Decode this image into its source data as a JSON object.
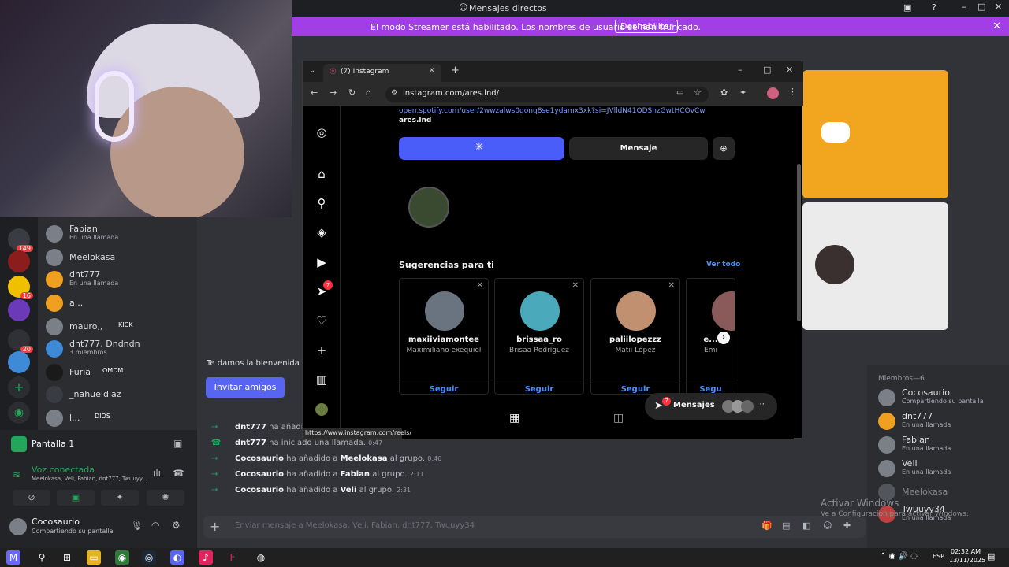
{
  "titlebar": {
    "title": "Mensajes directos"
  },
  "streamer_bar": {
    "message": "El modo Streamer está habilitado. Los nombres de usuario se han truncado.",
    "button": "Deshabilitar"
  },
  "servers": [
    {
      "badge": "149"
    },
    {
      "badge": ""
    },
    {
      "badge": "16"
    },
    {
      "badge": ""
    },
    {
      "badge": "20"
    },
    {
      "badge": ""
    }
  ],
  "dm_list": [
    {
      "name": "Fabian",
      "status": "En una llamada"
    },
    {
      "name": "Meelokasa",
      "status": ""
    },
    {
      "name": "dnt777",
      "status": "En una llamada"
    },
    {
      "name": "a...",
      "status": ""
    },
    {
      "name": "mauro,,",
      "tag": "KICK",
      "status": ""
    },
    {
      "name": "dnt777, Dndndn",
      "status": "3 miembros"
    },
    {
      "name": "Furia",
      "tag": "OMDM",
      "status": ""
    },
    {
      "name": "_nahueldiaz",
      "status": ""
    },
    {
      "name": "l...",
      "tag": "DIOS",
      "status": ""
    }
  ],
  "voice_panel": {
    "screen": "Pantalla 1",
    "voice_title": "Voz conectada",
    "voice_members": "Meelokasa, Veli, Fabian, dnt777, Twuuyy...",
    "user_name": "Cocosaurio",
    "user_status": "Compartiendo su pantalla"
  },
  "chat": {
    "welcome": "Te damos la bienvenida al c",
    "invite_button": "Invitar amigos",
    "messages": [
      {
        "actor": "dnt777",
        "text": "ha añadido a",
        "target": "",
        "suffix": "",
        "time": ""
      },
      {
        "actor": "dnt777",
        "text": "ha iniciado una llamada.",
        "target": "",
        "suffix": "",
        "time": "0:47"
      },
      {
        "actor": "Cocosaurio",
        "text": "ha añadido a",
        "target": "Meelokasa",
        "suffix": "al grupo.",
        "time": "0:46"
      },
      {
        "actor": "Cocosaurio",
        "text": "ha añadido a",
        "target": "Fabian",
        "suffix": "al grupo.",
        "time": "2:11"
      },
      {
        "actor": "Cocosaurio",
        "text": "ha añadido a",
        "target": "Veli",
        "suffix": "al grupo.",
        "time": "2:31"
      }
    ],
    "composer_placeholder": "Enviar mensaje a Meelokasa, Veli, Fabian, dnt777, Twuuyy34"
  },
  "members": {
    "header": "Miembros—6",
    "list": [
      {
        "name": "Cocosaurio",
        "status": "Compartiendo su pantalla"
      },
      {
        "name": "dnt777",
        "status": "En una llamada"
      },
      {
        "name": "Fabian",
        "status": "En una llamada"
      },
      {
        "name": "Veli",
        "status": "En una llamada"
      },
      {
        "name": "Meelokasa",
        "status": ""
      },
      {
        "name": "Twuuyy34",
        "status": "En una llamada"
      }
    ]
  },
  "watermark": {
    "line1": "Activar Windows",
    "line2": "Ve a Configuración para activar Windows."
  },
  "browser": {
    "tab_title": "(7) Instagram",
    "url": "instagram.com/ares.lnd/",
    "status_url": "https://www.instagram.com/reels/"
  },
  "instagram": {
    "spotify_link": "open.spotify.com/user/2wwzalws0qonq8se1ydamx3xk?si=JVlldN41QDShzGwtHCOvCw",
    "threads": "ares.lnd",
    "message_button": "Mensaje",
    "suggestions_title": "Sugerencias para ti",
    "see_all": "Ver todo",
    "suggestions": [
      {
        "user": "maxiiviamontee",
        "name": "Maximiliano exequiel",
        "follow": "Seguir"
      },
      {
        "user": "brissaa_ro",
        "name": "Brisaa Rodríguez",
        "follow": "Seguir"
      },
      {
        "user": "paliilopezzz",
        "name": "Matii López",
        "follow": "Seguir"
      },
      {
        "user": "e...",
        "name": "Emi",
        "follow": "Segu"
      }
    ],
    "notifications_badge": "7",
    "messages_pill": {
      "label": "Mensajes",
      "badge": "7"
    }
  },
  "taskbar": {
    "lang": "ESP",
    "time": "02:32 AM",
    "date": "13/11/2025"
  }
}
